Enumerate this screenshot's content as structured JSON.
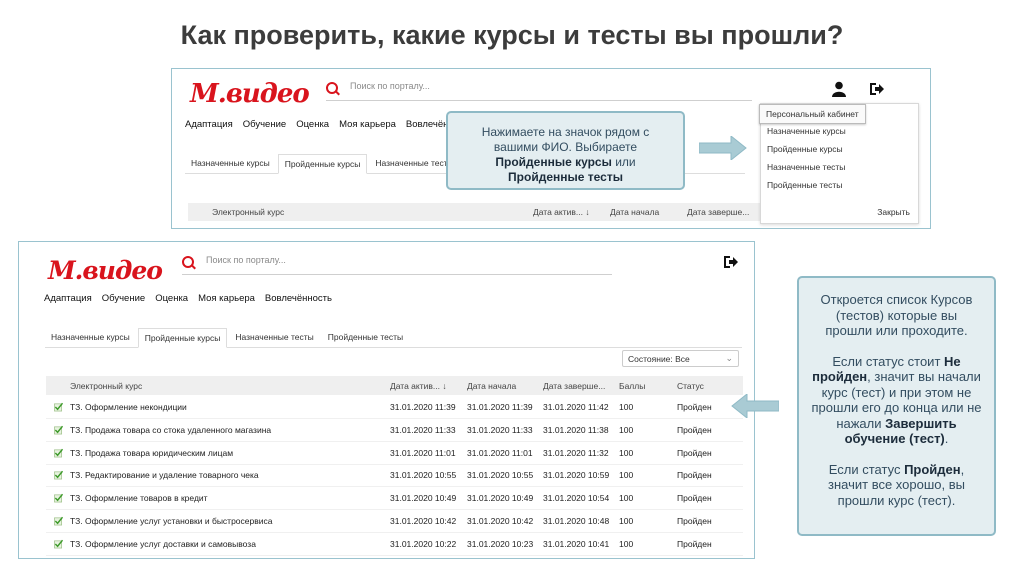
{
  "title": "Как проверить, какие курсы и тесты вы прошли?",
  "logo": "М.видео",
  "search_placeholder": "Поиск по порталу...",
  "nav1": [
    "Адаптация",
    "Обучение",
    "Оценка",
    "Моя карьера",
    "Вовлечённ"
  ],
  "nav2": [
    "Адаптация",
    "Обучение",
    "Оценка",
    "Моя карьера",
    "Вовлечённость"
  ],
  "tabs1": [
    "Назначенные курсы",
    "Пройденные курсы",
    "Назначенные тесты"
  ],
  "tabs2": [
    "Назначенные курсы",
    "Пройденные курсы",
    "Назначенные тесты",
    "Пройденные тесты"
  ],
  "dropdown": {
    "items": [
      "Персональный кабинет",
      "Назначенные курсы",
      "Пройденные курсы",
      "Назначенные тесты",
      "Пройденные тесты"
    ],
    "close": "Закрыть"
  },
  "status_filter": "Состояние: Все",
  "columns1": [
    "Электронный курс",
    "Дата актив... ↓",
    "Дата начала",
    "Дата заверше..."
  ],
  "columns2": [
    "Электронный курс",
    "Дата актив... ↓",
    "Дата начала",
    "Дата заверше...",
    "Баллы",
    "Статус"
  ],
  "rows": [
    {
      "name": "ТЗ. Оформление некондиции",
      "active": "31.01.2020 11:39",
      "start": "31.01.2020 11:39",
      "end": "31.01.2020 11:42",
      "score": "100",
      "status": "Пройден"
    },
    {
      "name": "ТЗ. Продажа товара со стока удаленного магазина",
      "active": "31.01.2020 11:33",
      "start": "31.01.2020 11:33",
      "end": "31.01.2020 11:38",
      "score": "100",
      "status": "Пройден"
    },
    {
      "name": "ТЗ. Продажа товара юридическим лицам",
      "active": "31.01.2020 11:01",
      "start": "31.01.2020 11:01",
      "end": "31.01.2020 11:32",
      "score": "100",
      "status": "Пройден"
    },
    {
      "name": "ТЗ. Редактирование и удаление товарного чека",
      "active": "31.01.2020 10:55",
      "start": "31.01.2020 10:55",
      "end": "31.01.2020 10:59",
      "score": "100",
      "status": "Пройден"
    },
    {
      "name": "ТЗ. Оформление товаров в кредит",
      "active": "31.01.2020 10:49",
      "start": "31.01.2020 10:49",
      "end": "31.01.2020 10:54",
      "score": "100",
      "status": "Пройден"
    },
    {
      "name": "ТЗ. Оформление услуг установки и быстросервиса",
      "active": "31.01.2020 10:42",
      "start": "31.01.2020 10:42",
      "end": "31.01.2020 10:48",
      "score": "100",
      "status": "Пройден"
    },
    {
      "name": "ТЗ. Оформление услуг доставки и самовывоза",
      "active": "31.01.2020 10:22",
      "start": "31.01.2020 10:23",
      "end": "31.01.2020 10:41",
      "score": "100",
      "status": "Пройден"
    }
  ],
  "callout1": {
    "line1": "Нажимаете на значок рядом с",
    "line2": "вашими ФИО. Выбираете",
    "bold1": "Пройденные курсы",
    "or": " или",
    "bold2": "Пройденные тесты"
  },
  "callout2": {
    "p1": "Откроется список Курсов (тестов) которые вы прошли или проходите.",
    "p2_a": "Если статус стоит ",
    "p2_b1": "Не пройден",
    "p2_c": ", значит вы начали курс (тест) и при этом не прошли его до конца или не нажали ",
    "p2_b2": "Завершить обучение (тест)",
    "p2_d": ".",
    "p3_a": "Если статус ",
    "p3_b": "Пройден",
    "p3_c": ", значит все хорошо, вы прошли курс (тест)."
  },
  "colors": {
    "brand": "#d9141d",
    "callout_bg": "#e4eef1",
    "callout_border": "#8fbac6",
    "arrow": "#8fbac6"
  }
}
